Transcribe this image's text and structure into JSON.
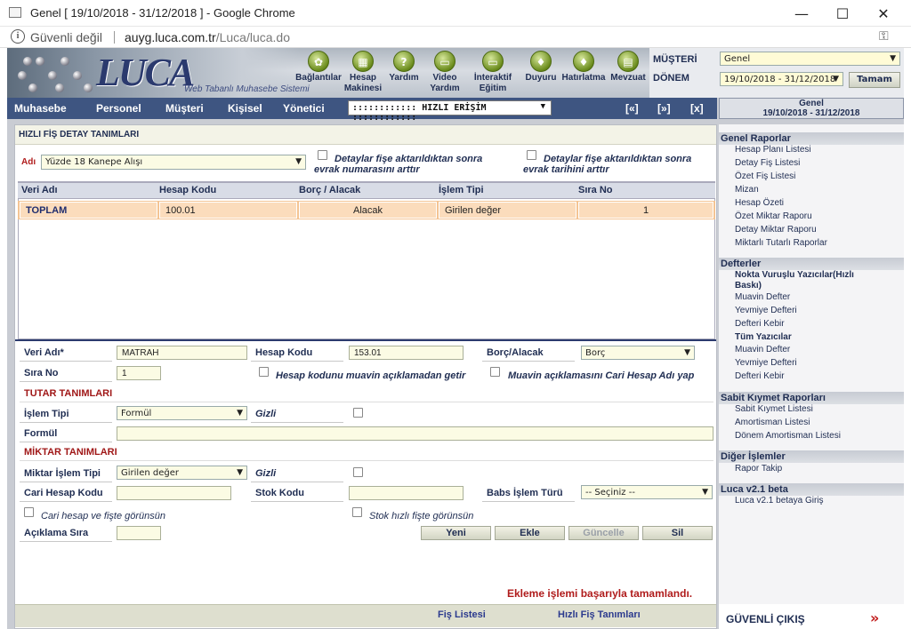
{
  "window": {
    "title": "Genel [ 19/10/2018 - 31/12/2018 ] - Google Chrome",
    "minimize": "—",
    "maximize": "☐",
    "close": "✕"
  },
  "address": {
    "security": "Güvenli değil",
    "host": "auyg.luca.com.tr",
    "path": "/Luca/luca.do"
  },
  "header": {
    "logo": "LUCA",
    "logo_sub": "Web Tabanlı Muhasebe Sistemi",
    "toolbar": [
      {
        "icon": "connections-icon",
        "glyph": "✿",
        "label1": "Bağlantılar",
        "label2": ""
      },
      {
        "icon": "calculator-icon",
        "glyph": "▦",
        "label1": "Hesap",
        "label2": "Makinesi"
      },
      {
        "icon": "help-icon",
        "glyph": "?",
        "label1": "Yardım",
        "label2": ""
      },
      {
        "icon": "video-help-icon",
        "glyph": "▭",
        "label1": "Video",
        "label2": "Yardım"
      },
      {
        "icon": "interactive-training-icon",
        "glyph": "▭",
        "label1": "İnteraktif",
        "label2": "Eğitim"
      },
      {
        "icon": "announcement-icon",
        "glyph": "♦",
        "label1": "Duyuru",
        "label2": ""
      },
      {
        "icon": "reminder-icon",
        "glyph": "♦",
        "label1": "Hatırlatma",
        "label2": ""
      },
      {
        "icon": "legislation-icon",
        "glyph": "▤",
        "label1": "Mevzuat",
        "label2": ""
      }
    ],
    "customer_label": "MÜŞTERİ",
    "customer_value": "Genel",
    "period_label": "DÖNEM",
    "period_value": "19/10/2018 - 31/12/2018",
    "ok_button": "Tamam"
  },
  "menu": {
    "items": [
      "Muhasebe",
      "Personel",
      "Müşteri",
      "Kişisel",
      "Yönetici"
    ],
    "quick_access": ":::::::::::: HIZLI ERİŞİM ::::::::::::",
    "nav_first": "[«]",
    "nav_next": "[»]",
    "nav_close": "[x]",
    "period_title": "Genel",
    "period_range": "19/10/2018 - 31/12/2018"
  },
  "form": {
    "title": "HIZLI FİŞ DETAY TANIMLARI",
    "name_label": "Adı",
    "name_value": "Yüzde 18 Kanepe Alışı",
    "opt1_line1": "Detaylar fişe aktarıldıktan sonra",
    "opt1_line2": "evrak numarasını arttır",
    "opt2_line1": "Detaylar fişe aktarıldıktan sonra",
    "opt2_line2": "evrak tarihini arttır"
  },
  "grid": {
    "headers": [
      "Veri Adı",
      "Hesap Kodu",
      "Borç / Alacak",
      "İşlem Tipi",
      "Sıra No"
    ],
    "rows": [
      [
        "TOPLAM",
        "100.01",
        "Alacak",
        "Girilen değer",
        "1"
      ]
    ]
  },
  "detail": {
    "veri_adi_label": "Veri Adı*",
    "veri_adi_value": "MATRAH",
    "hesap_kodu_label": "Hesap Kodu",
    "hesap_kodu_value": "153.01",
    "borc_alacak_label": "Borç/Alacak",
    "borc_alacak_value": "Borç",
    "sira_no_label": "Sıra No",
    "sira_no_value": "1",
    "muavin_desc_label": "Hesap kodunu muavin açıklamadan getir",
    "muavin_cari_label": "Muavin açıklamasını Cari Hesap Adı yap",
    "tutar_section": "TUTAR TANIMLARI",
    "islem_tipi_label": "İşlem Tipi",
    "islem_tipi_value": "Formül",
    "gizli_label": "Gizli",
    "formul_label": "Formül",
    "formul_value": "",
    "miktar_section": "MİKTAR TANIMLARI",
    "miktar_islem_label": "Miktar İşlem Tipi",
    "miktar_islem_value": "Girilen değer",
    "gizli2_label": "Gizli",
    "cari_hesap_label": "Cari Hesap Kodu",
    "stok_kodu_label": "Stok Kodu",
    "babs_label": "Babs İşlem Türü",
    "babs_value": "-- Seçiniz --",
    "cari_visible_label": "Cari hesap ve fişte görünsün",
    "stok_visible_label": "Stok hızlı fişte görünsün",
    "aciklama_sira_label": "Açıklama Sıra",
    "btn_new": "Yeni",
    "btn_add": "Ekle",
    "btn_update": "Güncelle",
    "btn_delete": "Sil"
  },
  "status": "Ekleme işlemi başarıyla tamamlandı.",
  "footer": {
    "link1": "Fiş Listesi",
    "link2": "Hızlı Fiş Tanımları"
  },
  "sidebar": {
    "groups": [
      {
        "title": "Genel Raporlar",
        "items": [
          "Hesap Planı Listesi",
          "Detay Fiş Listesi",
          "Özet Fiş Listesi",
          "Mizan",
          "Hesap Özeti",
          "Özet Miktar Raporu",
          "Detay Miktar Raporu",
          "Miktarlı Tutarlı Raporlar"
        ]
      },
      {
        "title": "Defterler",
        "sub1": "Nokta Vuruşlu Yazıcılar(Hızlı",
        "sub1b": "Baskı)",
        "items1": [
          "Muavin Defter",
          "Yevmiye Defteri",
          "Defteri Kebir"
        ],
        "sub2": "Tüm Yazıcılar",
        "items2": [
          "Muavin Defter",
          "Yevmiye Defteri",
          "Defteri Kebir"
        ]
      },
      {
        "title": "Sabit Kıymet Raporları",
        "items": [
          "Sabit Kıymet Listesi",
          "Amortisman Listesi",
          "Dönem Amortisman Listesi"
        ]
      },
      {
        "title": "Diğer İşlemler",
        "items": [
          "Rapor Takip"
        ]
      },
      {
        "title": "Luca v2.1 beta",
        "items": [
          "Luca v2.1 betaya Giriş"
        ]
      }
    ],
    "logout": "GÜVENLİ ÇIKIŞ",
    "logout_arrow": "»"
  }
}
